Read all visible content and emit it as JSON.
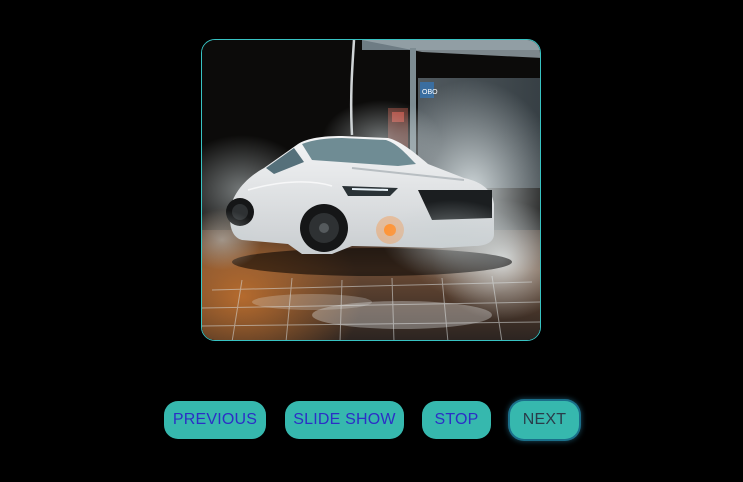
{
  "slideshow": {
    "image": {
      "subject": "white sports car in car wash with steam",
      "station_sign": "OBO"
    },
    "buttons": {
      "previous": "PREVIOUS",
      "slide_show": "SLIDE SHOW",
      "stop": "STOP",
      "next": "NEXT"
    },
    "focused_button": "next"
  },
  "colors": {
    "background": "#000000",
    "button_fill": "#36b8ae",
    "button_text": "#2c2ec6",
    "frame_border": "#38c3c3",
    "focus_ring": "#1a6f8a"
  }
}
